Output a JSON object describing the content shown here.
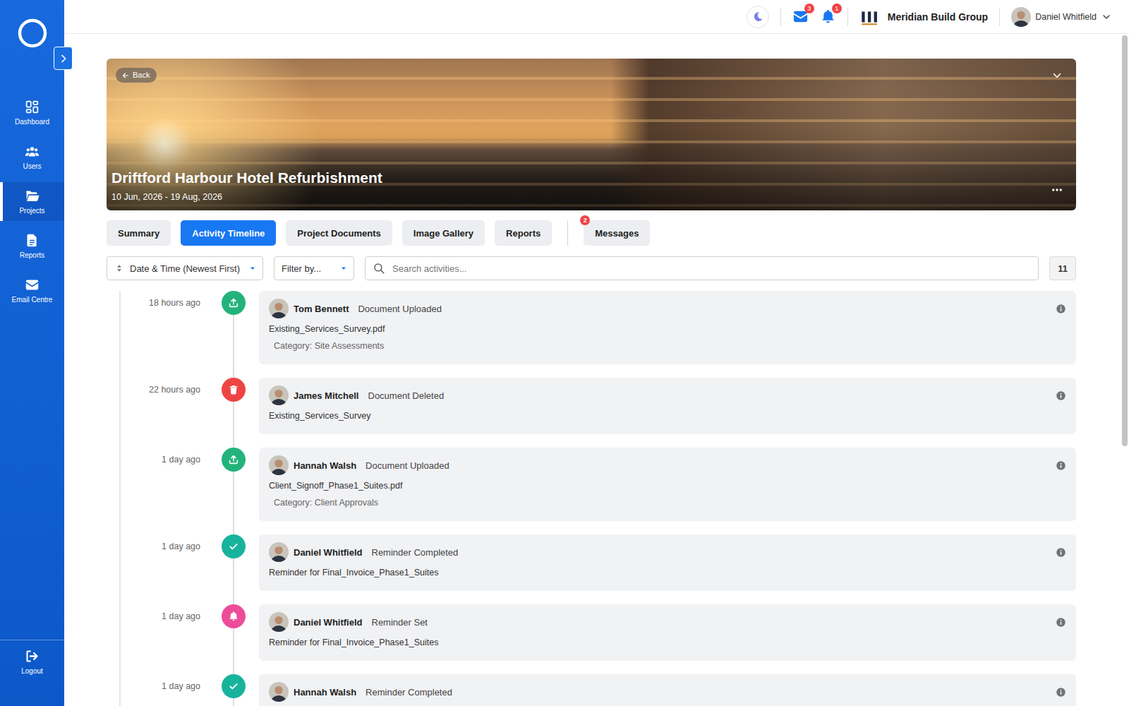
{
  "sidebar": {
    "items": [
      {
        "label": "Dashboard",
        "selected": false
      },
      {
        "label": "Users",
        "selected": false
      },
      {
        "label": "Projects",
        "selected": true
      },
      {
        "label": "Reports",
        "selected": false
      },
      {
        "label": "Email Centre",
        "selected": false
      }
    ],
    "logout": "Logout"
  },
  "topbar": {
    "mail_badge": "3",
    "notification_badge": "1",
    "company": "Meridian Build Group",
    "user": "Daniel Whitfield"
  },
  "project": {
    "back": "Back",
    "title": "Driftford Harbour Hotel Refurbishment",
    "dates": "10 Jun, 2026 - 19 Aug, 2026"
  },
  "tabs": [
    {
      "label": "Summary",
      "selected": false
    },
    {
      "label": "Activity Timeline",
      "selected": true
    },
    {
      "label": "Project Documents",
      "selected": false
    },
    {
      "label": "Image Gallery",
      "selected": false
    },
    {
      "label": "Reports",
      "selected": false
    },
    {
      "label": "Messages",
      "selected": false,
      "badge": "2"
    }
  ],
  "toolbar": {
    "sort": "Date & Time (Newest First)",
    "filter": "Filter by...",
    "search_placeholder": "Search activities...",
    "count": "11"
  },
  "activities": [
    {
      "time": "18 hours ago",
      "kind": "upload",
      "color": "#23b37a",
      "user": "Tom Bennett",
      "action": "Document Uploaded",
      "detail": "Existing_Services_Survey.pdf",
      "category": "Category: Site Assessments"
    },
    {
      "time": "22 hours ago",
      "kind": "delete",
      "color": "#ee4444",
      "user": "James Mitchell",
      "action": "Document Deleted",
      "detail": "Existing_Services_Survey"
    },
    {
      "time": "1 day ago",
      "kind": "upload",
      "color": "#23b37a",
      "user": "Hannah Walsh",
      "action": "Document Uploaded",
      "detail": "Client_Signoff_Phase1_Suites.pdf",
      "category": "Category: Client Approvals"
    },
    {
      "time": "1 day ago",
      "kind": "complete",
      "color": "#17b39c",
      "user": "Daniel Whitfield",
      "action": "Reminder Completed",
      "detail": "Reminder for Final_Invoice_Phase1_Suites"
    },
    {
      "time": "1 day ago",
      "kind": "reminder",
      "color": "#ec4c9a",
      "user": "Daniel Whitfield",
      "action": "Reminder Set",
      "detail": "Reminder for Final_Invoice_Phase1_Suites"
    },
    {
      "time": "1 day ago",
      "kind": "complete",
      "color": "#17b39c",
      "user": "Hannah Walsh",
      "action": "Reminder Completed"
    }
  ]
}
